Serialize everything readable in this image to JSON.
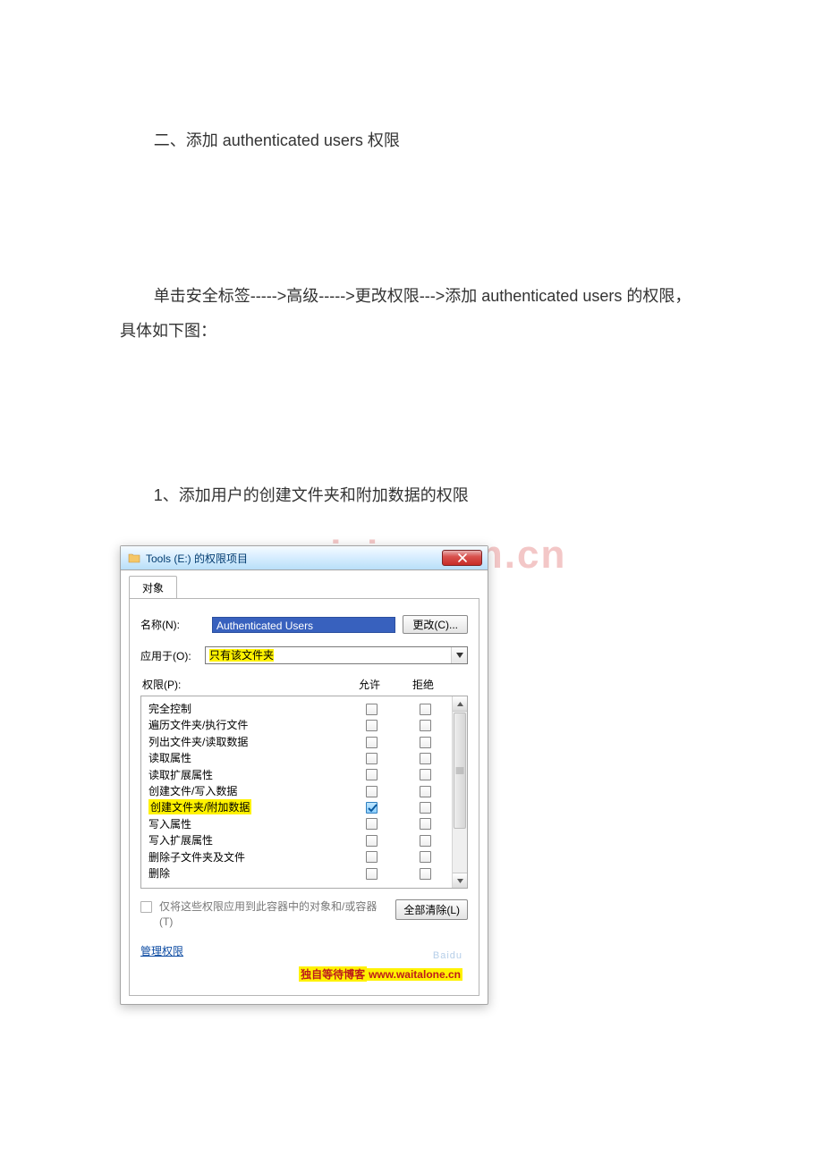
{
  "doc": {
    "heading": "二、添加 authenticated users 权限",
    "para1": "单击安全标签----->高级----->更改权限--->添加 authenticated users 的权限，具体如下图：",
    "step": "1、添加用户的创建文件夹和附加数据的权限"
  },
  "watermark": "www.zixin.com.cn",
  "dialog": {
    "title": "Tools (E:) 的权限项目",
    "tab": "对象",
    "name_label": "名称(N):",
    "name_value": "Authenticated Users",
    "change_btn": "更改(C)...",
    "apply_label": "应用于(O):",
    "apply_value": "只有该文件夹",
    "perm_label": "权限(P):",
    "col_allow": "允许",
    "col_deny": "拒绝",
    "permissions": [
      {
        "label": "完全控制",
        "allow": false,
        "deny": false
      },
      {
        "label": "遍历文件夹/执行文件",
        "allow": false,
        "deny": false
      },
      {
        "label": "列出文件夹/读取数据",
        "allow": false,
        "deny": false
      },
      {
        "label": "读取属性",
        "allow": false,
        "deny": false
      },
      {
        "label": "读取扩展属性",
        "allow": false,
        "deny": false
      },
      {
        "label": "创建文件/写入数据",
        "allow": false,
        "deny": false
      },
      {
        "label": "创建文件夹/附加数据",
        "allow": true,
        "deny": false,
        "highlight": true
      },
      {
        "label": "写入属性",
        "allow": false,
        "deny": false
      },
      {
        "label": "写入扩展属性",
        "allow": false,
        "deny": false
      },
      {
        "label": "删除子文件夹及文件",
        "allow": false,
        "deny": false
      },
      {
        "label": "删除",
        "allow": false,
        "deny": false
      }
    ],
    "apply_only_label": "仅将这些权限应用到此容器中的对象和/或容器(T)",
    "clear_all": "全部清除(L)",
    "manage_link": "管理权限",
    "footer_prefix": "独自等待博客",
    "footer_url": "www.waitalone.cn",
    "footer_ghost": "Baidu"
  }
}
